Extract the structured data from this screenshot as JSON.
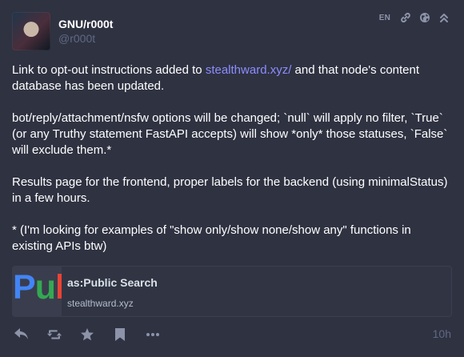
{
  "account": {
    "display_name": "GNU/r000t",
    "username": "@r000t"
  },
  "header": {
    "language": "EN",
    "icons": [
      "link-icon",
      "globe-icon",
      "collapse-icon"
    ]
  },
  "content": {
    "p1_before": "Link to opt-out instructions added to ",
    "p1_link": "stealthward.xyz/",
    "p1_after": " and that node's content database has been updated.",
    "p2": "bot/reply/attachment/nsfw options will be changed; `null` will apply no filter, `True` (or any Truthy statement FastAPI accepts) will show *only* those statuses, `False` will exclude them.*",
    "p3": "Results page for the frontend, proper labels for the backend (using minimalStatus) in a few hours.",
    "p4": "* (I'm looking for examples of \"show only/show none/show any\" functions in existing APIs btw)"
  },
  "card": {
    "thumb_text": "Pub",
    "title": "as:Public Search",
    "host": "stealthward.xyz"
  },
  "actions": {
    "icons": [
      "reply-icon",
      "boost-icon",
      "favourite-icon",
      "bookmark-icon",
      "more-icon"
    ]
  },
  "timestamp": "10h",
  "colors": {
    "background": "#2f3241",
    "link": "#8c8dff",
    "muted": "#606984",
    "icon": "#8d93a9",
    "thumb_blue": "#4285f4",
    "thumb_green": "#34a853",
    "thumb_red": "#ea4335"
  }
}
